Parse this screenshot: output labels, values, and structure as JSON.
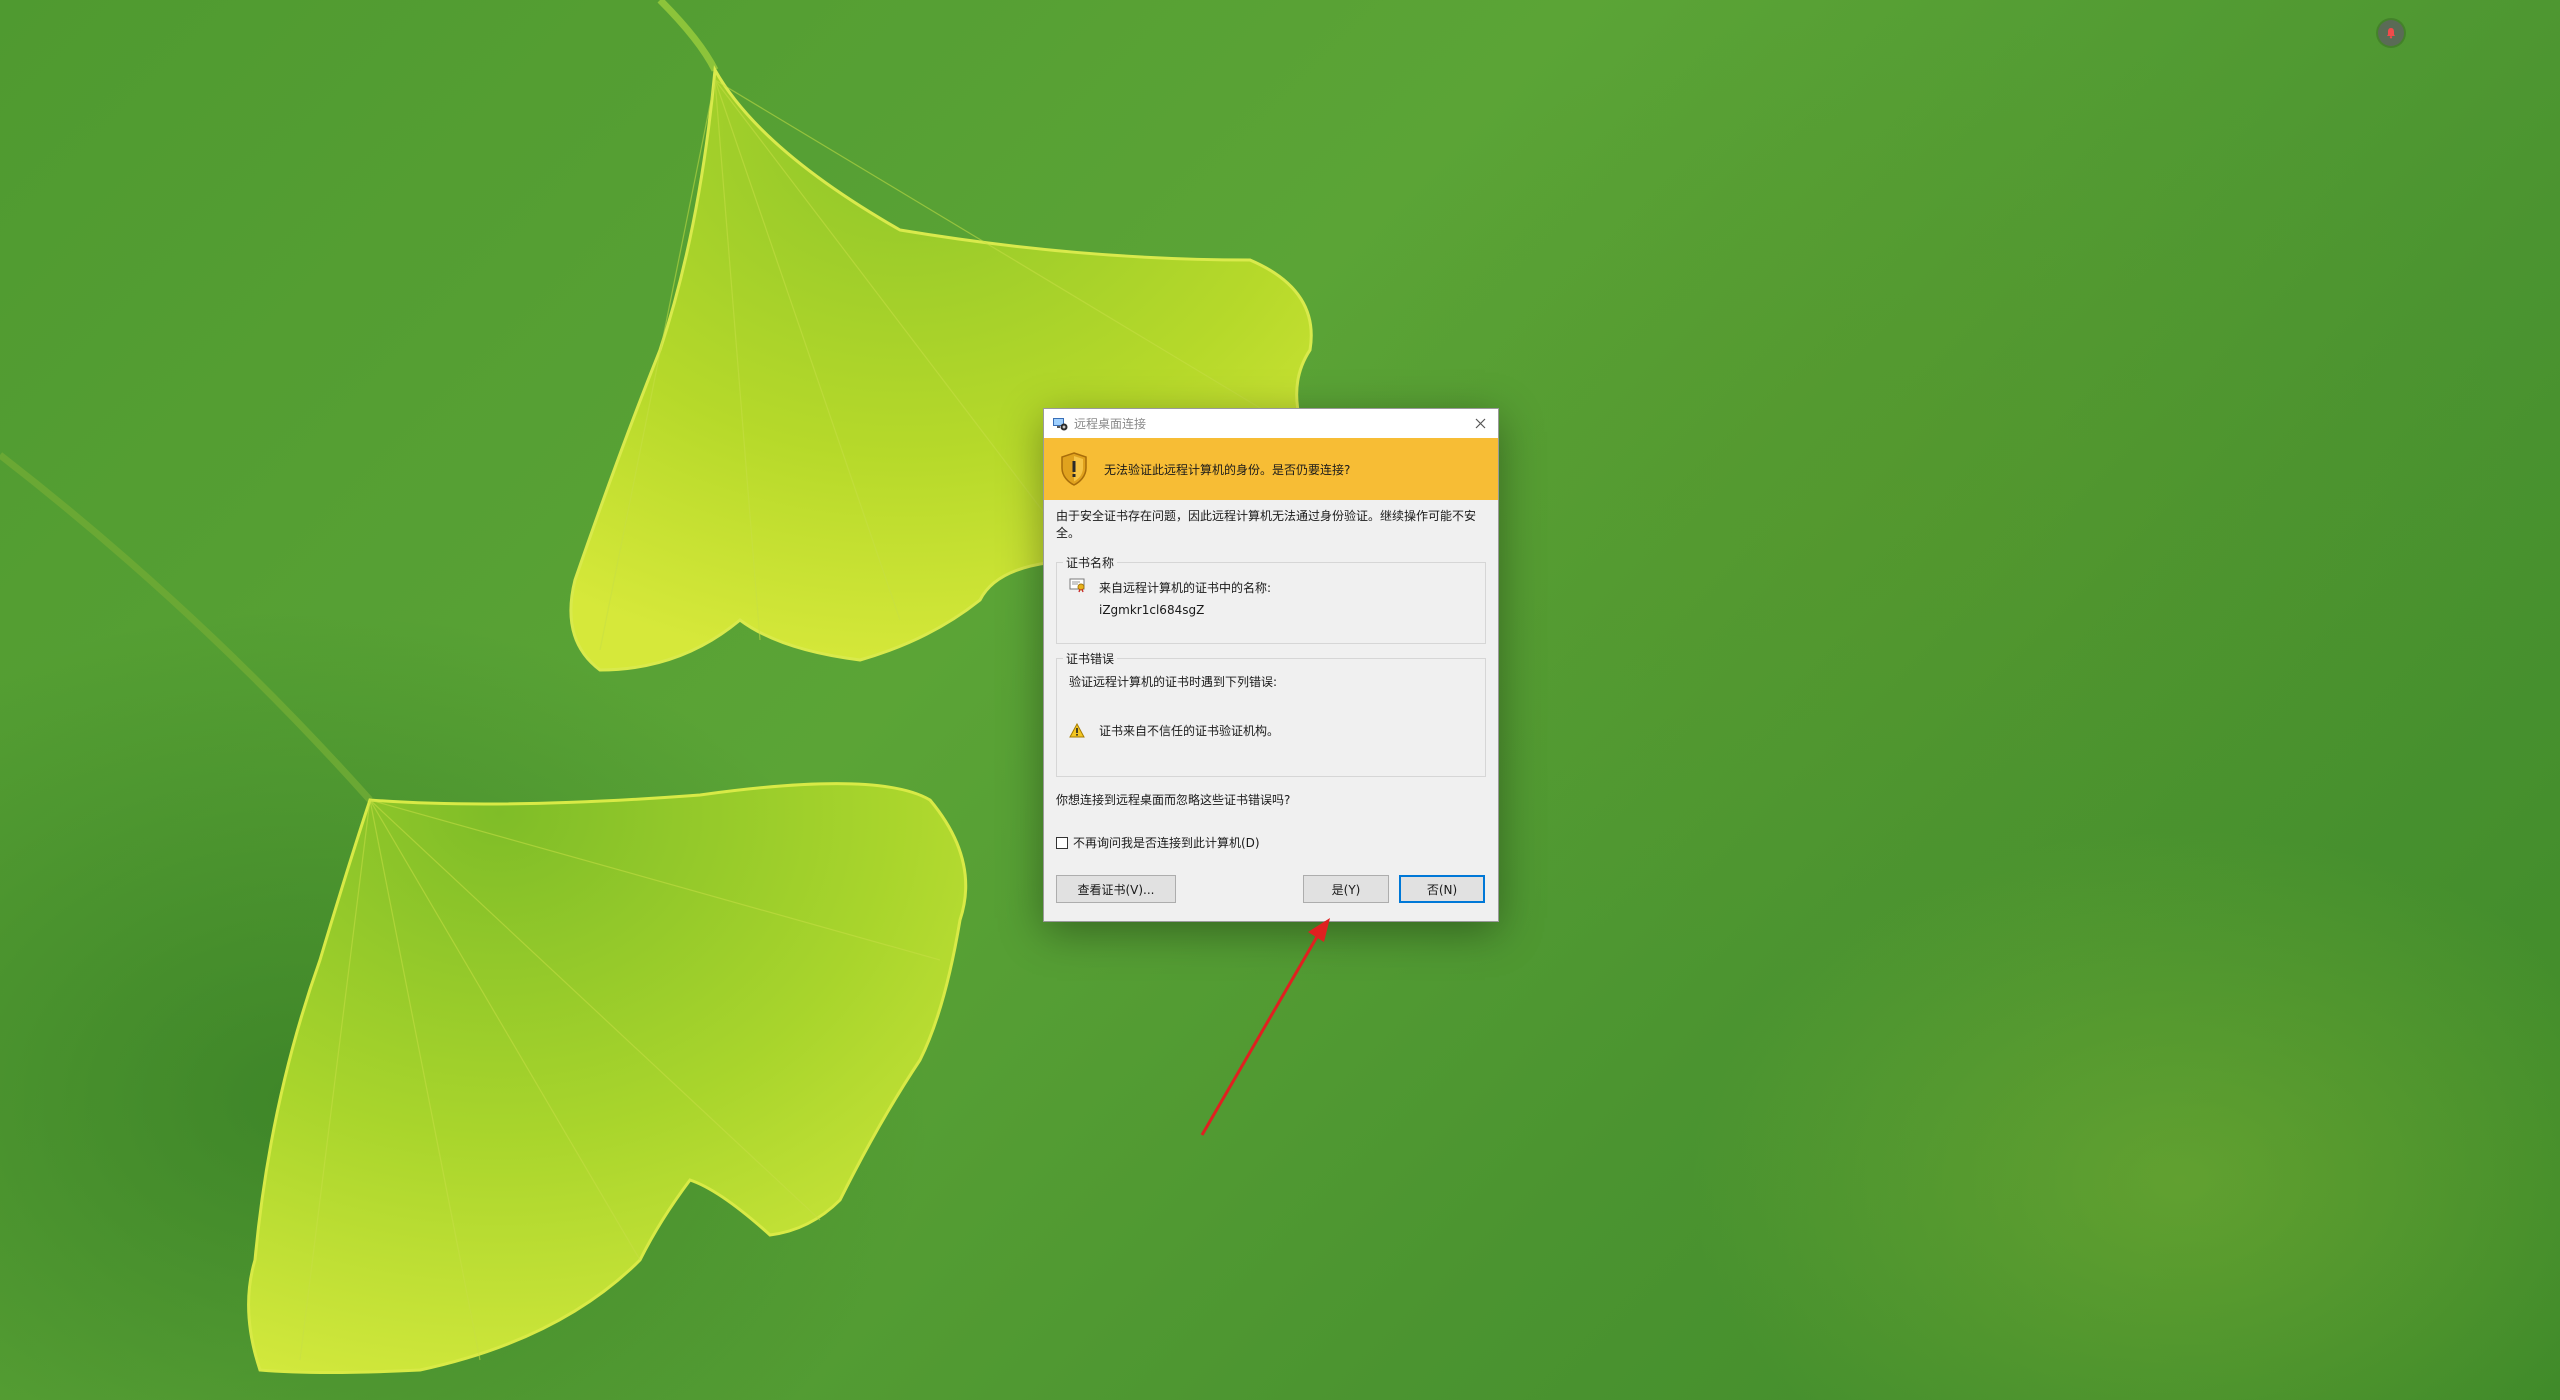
{
  "dialog": {
    "title": "远程桌面连接",
    "banner_text": "无法验证此远程计算机的身份。是否仍要连接?",
    "description": "由于安全证书存在问题，因此远程计算机无法通过身份验证。继续操作可能不安全。",
    "cert_name_group": {
      "legend": "证书名称",
      "label": "来自远程计算机的证书中的名称:",
      "value": "iZgmkr1cl684sgZ"
    },
    "cert_error_group": {
      "legend": "证书错误",
      "intro": "验证远程计算机的证书时遇到下列错误:",
      "error": "证书来自不信任的证书验证机构。"
    },
    "question": "你想连接到远程桌面而忽略这些证书错误吗?",
    "checkbox_label": "不再询问我是否连接到此计算机(D)",
    "checkbox_checked": false,
    "buttons": {
      "view_cert": "查看证书(V)...",
      "yes": "是(Y)",
      "no": "否(N)"
    }
  },
  "colors": {
    "banner": "#f7bd35",
    "primary_border": "#0078d7",
    "annotation_arrow": "#e02020"
  }
}
